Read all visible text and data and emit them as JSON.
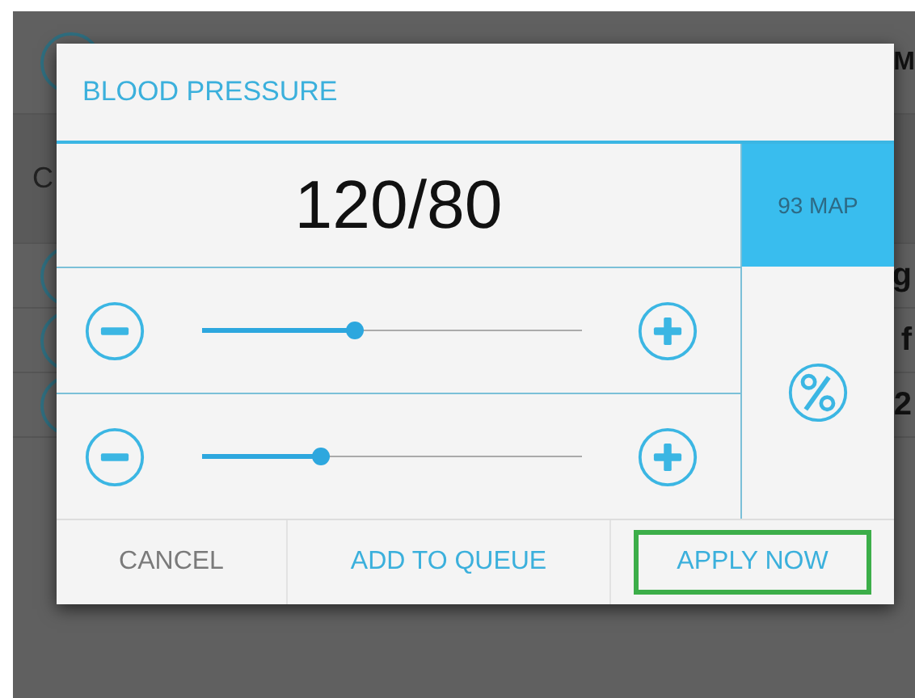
{
  "background_rows": [
    {
      "kind": "avatar",
      "text": "M"
    },
    {
      "kind": "header",
      "text": "C"
    },
    {
      "kind": "avatar",
      "text": "g"
    },
    {
      "kind": "avatar",
      "text": "f"
    },
    {
      "kind": "avatar",
      "text": "2"
    }
  ],
  "dialog": {
    "title": "BLOOD PRESSURE",
    "reading": "120/80",
    "map": "93 MAP",
    "sliders": [
      {
        "level": 0.4
      },
      {
        "level": 0.31
      }
    ],
    "buttons": [
      {
        "label": "CANCEL",
        "kind": "neutral",
        "highlighted": false
      },
      {
        "label": "ADD TO QUEUE",
        "kind": "accent",
        "highlighted": false
      },
      {
        "label": "APPLY NOW",
        "kind": "accent",
        "highlighted": true
      }
    ]
  }
}
